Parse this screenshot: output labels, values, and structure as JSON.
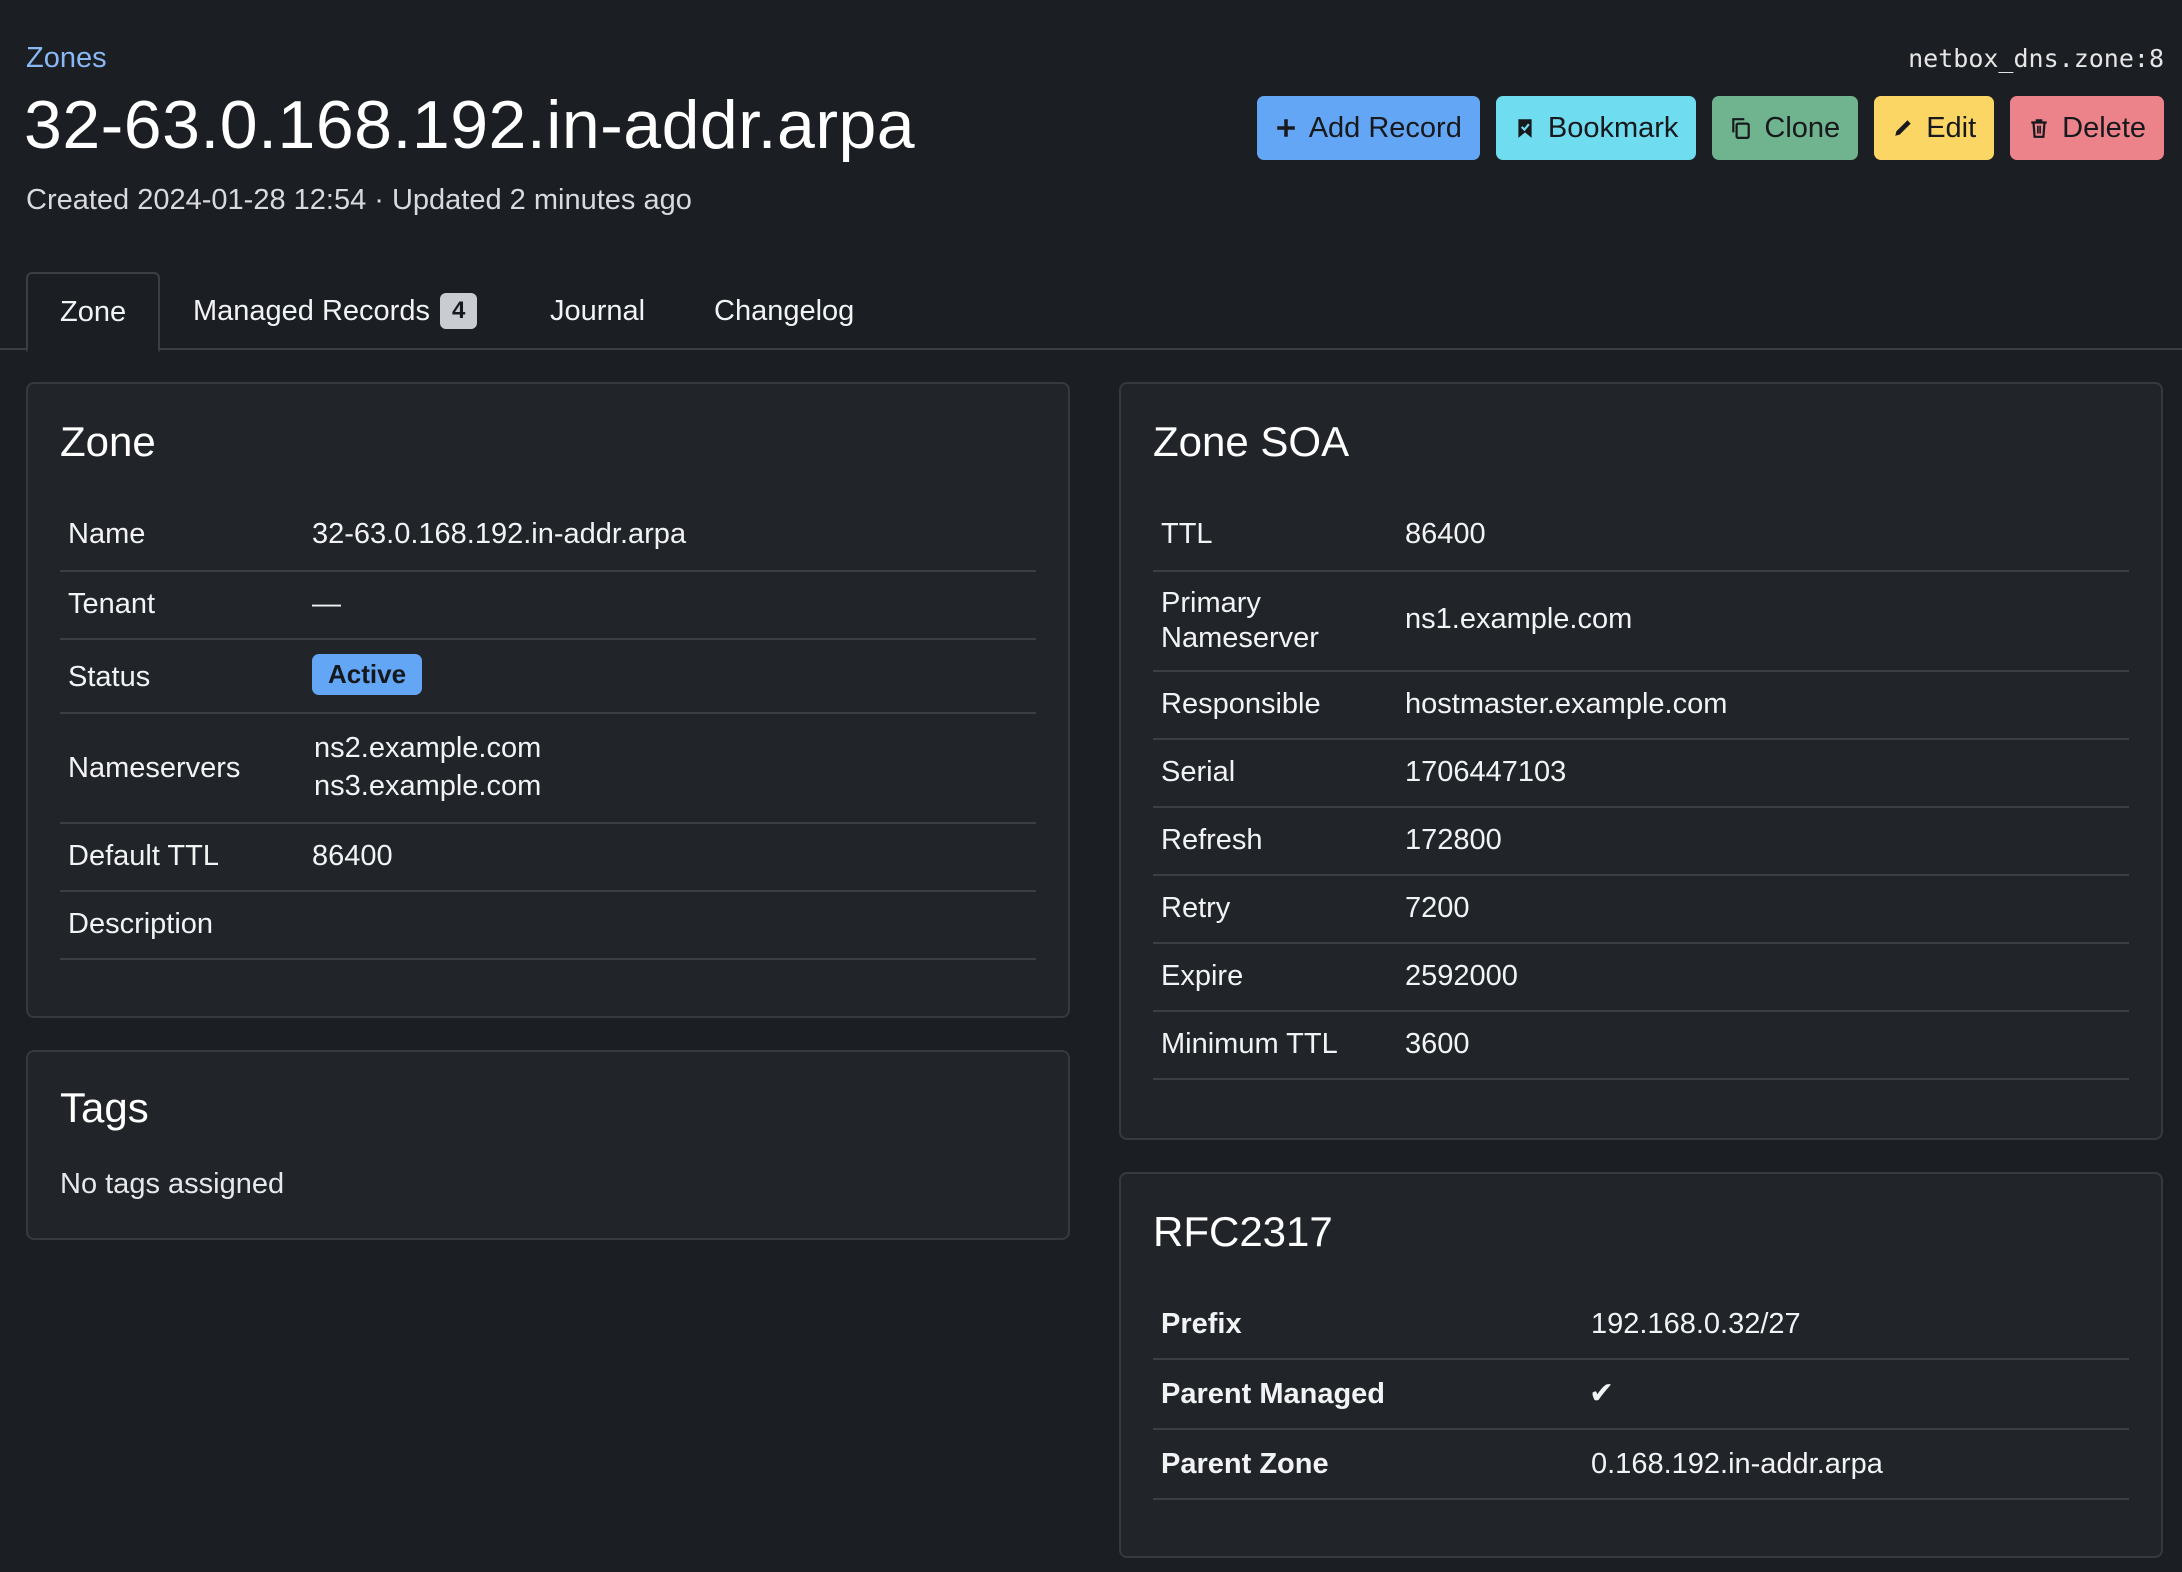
{
  "breadcrumb": "Zones",
  "object_id": "netbox_dns.zone:8",
  "title": "32-63.0.168.192.in-addr.arpa",
  "subtitle": "Created 2024-01-28 12:54 · Updated 2 minutes ago",
  "actions": {
    "add_record": "Add Record",
    "bookmark": "Bookmark",
    "clone": "Clone",
    "edit": "Edit",
    "delete": "Delete"
  },
  "tabs": {
    "zone": "Zone",
    "managed_records": "Managed Records",
    "managed_records_count": "4",
    "journal": "Journal",
    "changelog": "Changelog"
  },
  "zone_card": {
    "title": "Zone",
    "name_label": "Name",
    "name_value": "32-63.0.168.192.in-addr.arpa",
    "tenant_label": "Tenant",
    "tenant_value": "—",
    "status_label": "Status",
    "status_value": "Active",
    "nameservers_label": "Nameservers",
    "nameservers": [
      "ns2.example.com",
      "ns3.example.com"
    ],
    "default_ttl_label": "Default TTL",
    "default_ttl_value": "86400",
    "description_label": "Description",
    "description_value": ""
  },
  "tags_card": {
    "title": "Tags",
    "empty_text": "No tags assigned"
  },
  "soa_card": {
    "title": "Zone SOA",
    "ttl_label": "TTL",
    "ttl_value": "86400",
    "primary_ns_label_1": "Primary",
    "primary_ns_label_2": "Nameserver",
    "primary_ns_value": "ns1.example.com",
    "responsible_label": "Responsible",
    "responsible_value": "hostmaster.example.com",
    "serial_label": "Serial",
    "serial_value": "1706447103",
    "refresh_label": "Refresh",
    "refresh_value": "172800",
    "retry_label": "Retry",
    "retry_value": "7200",
    "expire_label": "Expire",
    "expire_value": "2592000",
    "minimum_ttl_label": "Minimum TTL",
    "minimum_ttl_value": "3600"
  },
  "rfc_card": {
    "title": "RFC2317",
    "prefix_label": "Prefix",
    "prefix_value": "192.168.0.32/27",
    "parent_managed_label": "Parent Managed",
    "parent_managed_value": "✔",
    "parent_zone_label": "Parent Zone",
    "parent_zone_value": "0.168.192.in-addr.arpa"
  },
  "colors": {
    "background": "#1b1e22",
    "card": "#212428",
    "link": "#8ab8f5",
    "primary": "#63a6f6",
    "info": "#6fdcf0",
    "success": "#6fb38f",
    "warning": "#fbd665",
    "danger": "#ec838a"
  },
  "icons": {
    "add": "plus-icon",
    "bookmark": "bookmark-icon",
    "clone": "copy-icon",
    "edit": "pencil-icon",
    "delete": "trash-icon",
    "parent_managed": "check-icon"
  }
}
